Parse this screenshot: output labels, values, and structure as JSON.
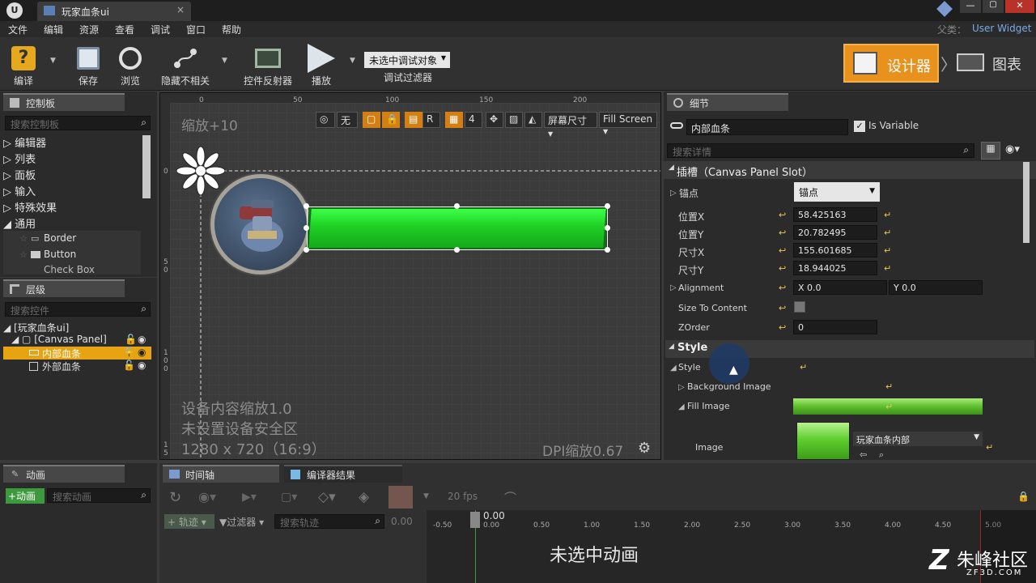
{
  "app": {
    "tab_title": "玩家血条ui",
    "parent_label": "父类：",
    "parent_class": "User Widget"
  },
  "menu": [
    "文件",
    "编辑",
    "资源",
    "查看",
    "调试",
    "窗口",
    "帮助"
  ],
  "toolbar": {
    "compile": "编译",
    "save": "保存",
    "browse": "浏览",
    "hide_unrelated": "隐藏不相关",
    "widget_reflector": "控件反射器",
    "play": "播放",
    "debug_object": "未选中调试对象",
    "debug_filter": "调试过滤器",
    "designer": "设计器",
    "graph": "图表"
  },
  "palette": {
    "tab": "控制板",
    "search_placeholder": "搜索控制板",
    "categories": [
      "编辑器",
      "列表",
      "面板",
      "输入",
      "特殊效果",
      "通用"
    ],
    "items": [
      "Border",
      "Button",
      "Check Box"
    ]
  },
  "hierarchy": {
    "tab": "层级",
    "search_placeholder": "搜索控件",
    "root": "[玩家血条ui]",
    "canvas": "[Canvas Panel]",
    "children": [
      "内部血条",
      "外部血条"
    ]
  },
  "viewport": {
    "zoom": "缩放+10",
    "scale_none": "无",
    "r_label": "R",
    "grid_num": "4",
    "screen_size": "屏幕尺寸",
    "fill_mode": "Fill Screen",
    "ruler_top": [
      "0",
      "50",
      "100",
      "150",
      "200"
    ],
    "ruler_left": [
      "0",
      "5",
      "0",
      "1",
      "0",
      "0",
      "1",
      "5"
    ],
    "info_lines": [
      "设备内容缩放1.0",
      "未设置设备安全区",
      "1280 x 720（16:9）"
    ],
    "dpi": "DPI缩放0.67"
  },
  "details": {
    "tab": "细节",
    "name": "内部血条",
    "is_variable": "Is Variable",
    "search_placeholder": "搜索详情",
    "slot_header": "插槽（Canvas Panel Slot）",
    "anchor_label": "锚点",
    "anchor_value": "锚点",
    "rows": [
      {
        "label": "位置X",
        "value": "58.425163"
      },
      {
        "label": "位置Y",
        "value": "20.782495"
      },
      {
        "label": "尺寸X",
        "value": "155.601685"
      },
      {
        "label": "尺寸Y",
        "value": "18.944025"
      }
    ],
    "alignment_label": "Alignment",
    "align_x": "X  0.0",
    "align_y": "Y  0.0",
    "size_to_content": "Size To Content",
    "zorder_label": "ZOrder",
    "zorder_value": "0",
    "style_section": "Style",
    "style_label": "Style",
    "background_image": "Background Image",
    "fill_image": "Fill Image",
    "image_label": "Image",
    "image_asset": "玩家血条内部"
  },
  "bottom": {
    "animation_tab": "动画",
    "add_animation": "+动画",
    "search_animation": "搜索动画",
    "timeline_tab": "时间轴",
    "compiler_tab": "编译器结果",
    "fps": "20 fps",
    "track": "轨迹",
    "filter": "过滤器",
    "search_track": "搜索轨迹",
    "time_value": "0.00",
    "cursor_time": "0.00",
    "timeline_ticks": [
      "-0.50",
      "0.00",
      "0.50",
      "1.00",
      "1.50",
      "2.00",
      "2.50",
      "3.00",
      "3.50",
      "4.00",
      "4.50",
      "5.00"
    ],
    "no_animation": "未选中动画"
  },
  "watermark": {
    "brand": "朱峰社区",
    "url": "ZF3D.COM"
  }
}
